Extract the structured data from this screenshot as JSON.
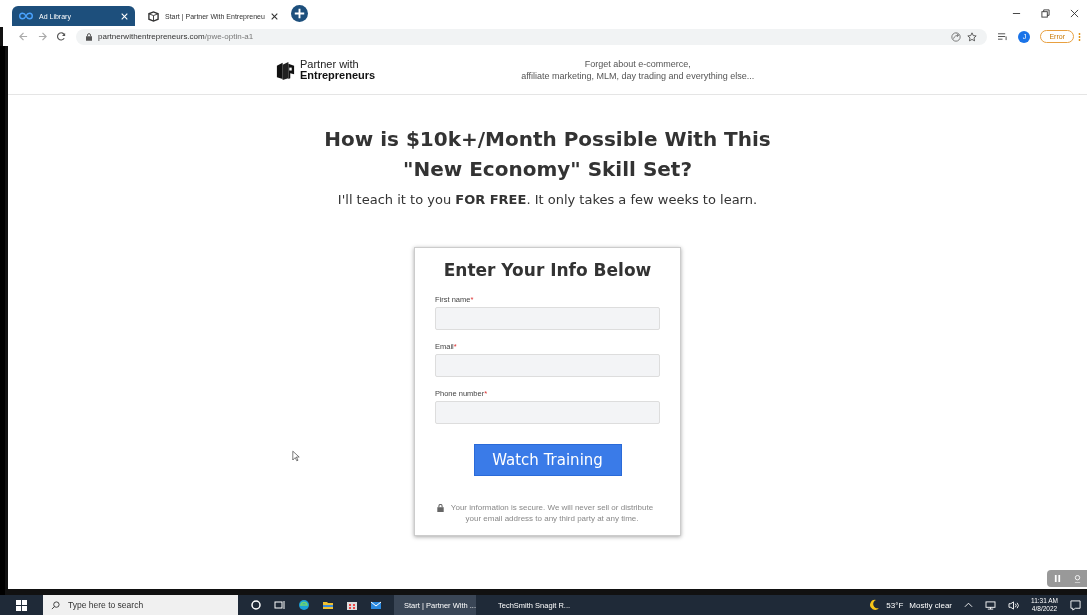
{
  "browser": {
    "tabs": [
      {
        "title": "Ad Library",
        "selected": false,
        "color": "#1d4f7c"
      },
      {
        "title": "Start | Partner With Entrepreneu",
        "selected": true,
        "color": "#ffffff"
      }
    ],
    "url_host": "partnerwithentrepreneurs.com",
    "url_path": "/pwe-optin-a1",
    "profile_initial": "J",
    "error_label": "Error"
  },
  "header": {
    "logo_line_1": "Partner with",
    "logo_line_2": "Entrepreneurs",
    "tagline_1": "Forget about e-commerce,",
    "tagline_2": "affiliate marketing, MLM, day trading and everything else..."
  },
  "hero": {
    "headline_1": "How is $10k+/Month Possible With This",
    "headline_2": "\"New Economy\" Skill Set?",
    "subtitle": "I'll teach it to you **FOR FREE**. It only takes a few weeks to learn."
  },
  "form": {
    "title": "Enter Your Info Below",
    "fields": [
      {
        "label": "First name",
        "required_mark": "*"
      },
      {
        "label": "Email",
        "required_mark": "*"
      },
      {
        "label": "Phone number",
        "required_mark": "*"
      }
    ],
    "button": "Watch Training",
    "privacy_note": "Your information is secure. We will never sell or distribute your email address to any third party at any time."
  },
  "taskbar": {
    "search_placeholder": "Type here to search",
    "apps": [
      {
        "kind": "cortana"
      },
      {
        "kind": "taskview"
      },
      {
        "kind": "edge"
      },
      {
        "kind": "explorer"
      },
      {
        "kind": "store"
      },
      {
        "kind": "mail"
      },
      {
        "kind": "chrome",
        "label": "Start | Partner With ..."
      },
      {
        "kind": "snagit",
        "label": "TechSmith Snagit R..."
      }
    ],
    "temperature": "53°F",
    "weather": "Mostly clear",
    "time": "11:31 AM",
    "date": "4/8/2022"
  }
}
